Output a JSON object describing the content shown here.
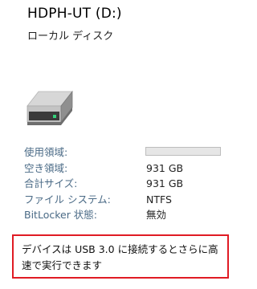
{
  "header": {
    "title": "HDPH-UT (D:)",
    "subtitle": "ローカル ディスク"
  },
  "drive": {
    "icon": "hard-drive-icon",
    "led_color": "#33d17a"
  },
  "properties": {
    "used": {
      "label": "使用領域:",
      "fraction": 0.0
    },
    "free": {
      "label": "空き領域:",
      "value": "931 GB"
    },
    "total": {
      "label": "合計サイズ:",
      "value": "931 GB"
    },
    "filesystem": {
      "label": "ファイル システム:",
      "value": "NTFS"
    },
    "bitlocker": {
      "label": "BitLocker 状態:",
      "value": "無効"
    }
  },
  "notice": {
    "text": "デバイスは USB 3.0 に接続するとさらに高速で実行できます",
    "border_color": "#e01b24"
  }
}
